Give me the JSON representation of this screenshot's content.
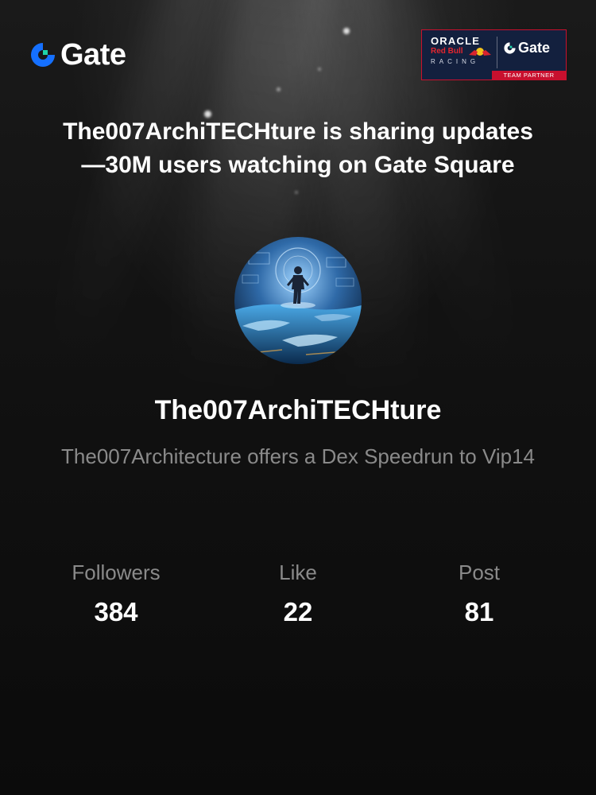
{
  "brand": {
    "name": "Gate",
    "accent": "#1570ff",
    "accent_secondary": "#1fd4a9"
  },
  "partner_badge": {
    "line1": "ORACLE",
    "line2": "Red Bull",
    "line3": "RACING",
    "gate": "Gate",
    "footer": "TEAM PARTNER"
  },
  "headline": {
    "line1": "The007ArchiTECHture is sharing updates",
    "line2": "—30M users watching on Gate Square"
  },
  "profile": {
    "avatar_icon": "avatar-cyber-figure",
    "username": "The007ArchiTECHture",
    "bio": "The007Architecture offers a Dex Speedrun to Vip14"
  },
  "stats": [
    {
      "label": "Followers",
      "value": "384"
    },
    {
      "label": "Like",
      "value": "22"
    },
    {
      "label": "Post",
      "value": "81"
    }
  ]
}
